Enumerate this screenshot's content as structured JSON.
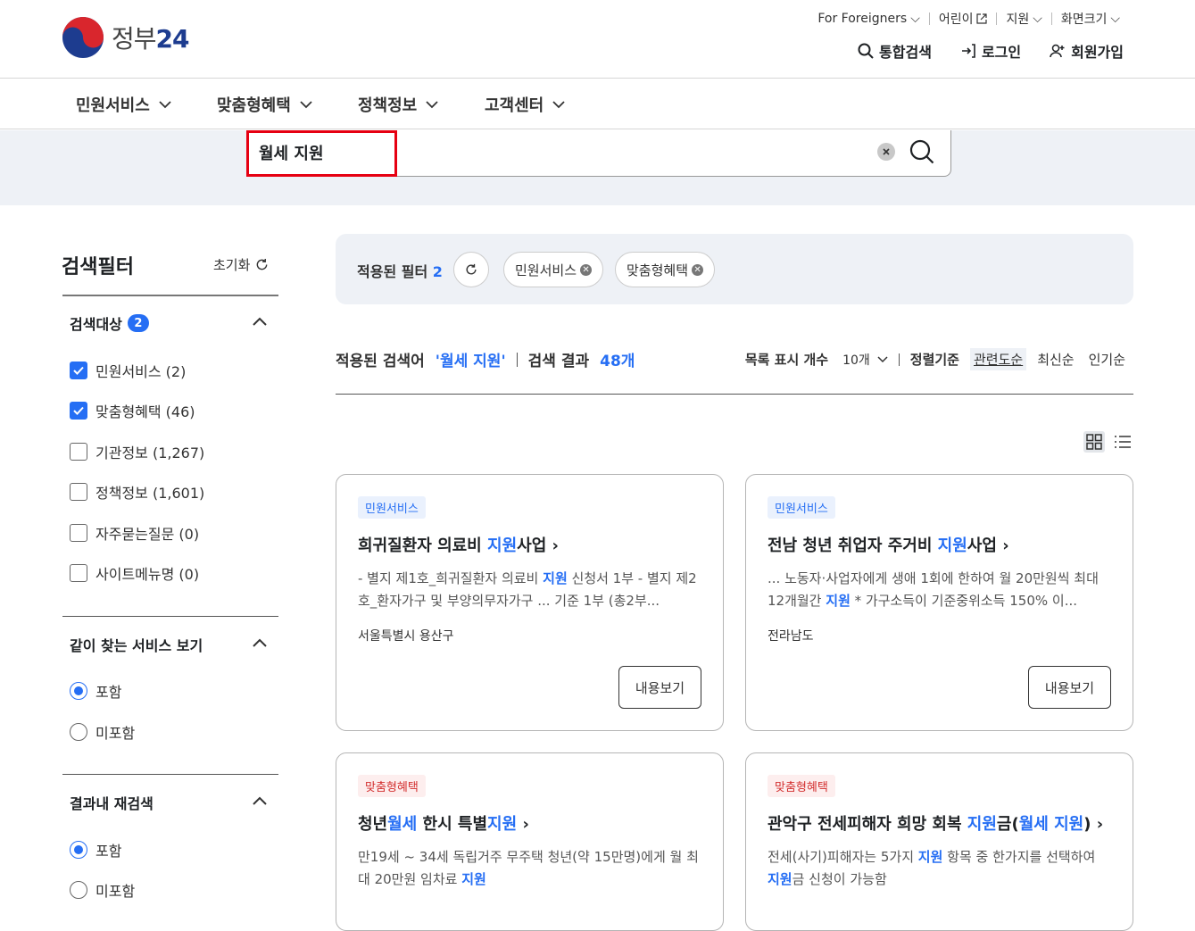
{
  "header": {
    "logo_text": "정부",
    "logo_num": "24",
    "utility": [
      {
        "label": "For Foreigners"
      },
      {
        "label": "어린이"
      },
      {
        "label": "지원"
      },
      {
        "label": "화면크기"
      }
    ],
    "user_menu": {
      "search": "통합검색",
      "login": "로그인",
      "signup": "회원가입"
    }
  },
  "gnb": [
    "민원서비스",
    "맞춤형혜택",
    "정책정보",
    "고객센터"
  ],
  "search": {
    "value": "월세 지원"
  },
  "sidebar": {
    "title": "검색필터",
    "reset": "초기화",
    "target": {
      "title": "검색대상",
      "count": "2",
      "options": [
        {
          "label": "민원서비스 (2)",
          "checked": true
        },
        {
          "label": "맞춤형혜택 (46)",
          "checked": true
        },
        {
          "label": "기관정보 (1,267)",
          "checked": false
        },
        {
          "label": "정책정보 (1,601)",
          "checked": false
        },
        {
          "label": "자주묻는질문 (0)",
          "checked": false
        },
        {
          "label": "사이트메뉴명 (0)",
          "checked": false
        }
      ]
    },
    "related": {
      "title": "같이 찾는 서비스 보기",
      "options": [
        {
          "label": "포함",
          "selected": true
        },
        {
          "label": "미포함",
          "selected": false
        }
      ]
    },
    "research": {
      "title": "결과내 재검색",
      "options": [
        {
          "label": "포함",
          "selected": true
        },
        {
          "label": "미포함",
          "selected": false
        }
      ]
    }
  },
  "applied": {
    "label": "적용된 필터",
    "count": "2",
    "chips": [
      "민원서비스",
      "맞춤형혜택"
    ]
  },
  "summary": {
    "label": "적용된 검색어",
    "keyword": "'월세 지원'",
    "result_label": "검색 결과",
    "result_count": "48개"
  },
  "list_options": {
    "count_label": "목록 표시 개수",
    "count_value": "10개",
    "sort_label": "정렬기준",
    "sorts": [
      "관련도순",
      "최신순",
      "인기순"
    ],
    "active_sort": "관련도순"
  },
  "cards": [
    {
      "tag": "민원서비스",
      "title": [
        "희귀질환자 의료비 ",
        "지원",
        "사업"
      ],
      "desc": [
        "- 별지 제1호_희귀질환자 의료비 ",
        "지원",
        " 신청서 1부 - 별지 제2호_환자가구 및 부양의무자가구 ... 기준 1부 (총2부..."
      ],
      "org": "서울특별시 용산구",
      "button": "내용보기"
    },
    {
      "tag": "민원서비스",
      "title": [
        "전남 청년 취업자 주거비 ",
        "지원",
        "사업"
      ],
      "desc": [
        "... 노동자·사업자에게 생애 1회에 한하여 월 20만원씩 최대 12개월간 ",
        "지원",
        " * 가구소득이 기준중위소득 150% 이..."
      ],
      "org": "전라남도",
      "button": "내용보기"
    },
    {
      "tag": "맞춤형혜택",
      "title": [
        "청년",
        "월세",
        " 한시 특별",
        "지원"
      ],
      "desc": [
        "만19세 ~ 34세 독립거주 무주택 청년(약 15만명)에게 월 최대 20만원 임차료 ",
        "지원"
      ]
    },
    {
      "tag": "맞춤형혜택",
      "title": [
        "관악구 전세피해자 희망 회복 ",
        "지원",
        "금(",
        "월세 지원",
        ")"
      ],
      "desc": [
        "전세(사기)피해자는 5가지 ",
        "지원",
        " 항목 중 한가지를 선택하여 ",
        "지원",
        "금 신청이 가능함"
      ]
    }
  ]
}
